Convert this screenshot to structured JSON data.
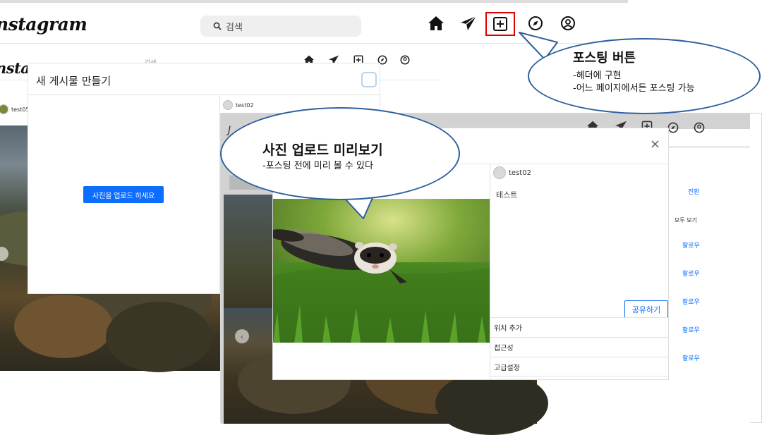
{
  "top_header": {
    "logo": "nstagram",
    "search_placeholder": "검색",
    "icons": [
      "home-icon",
      "send-icon",
      "new-post-icon",
      "compass-icon",
      "profile-icon"
    ]
  },
  "callout_posting": {
    "title": "포스팅 버튼",
    "line1": "-헤더에 구현",
    "line2": "-어느 페이지에서든 포스팅 가능"
  },
  "callout_preview": {
    "title": "사진 업로드 미리보기",
    "line1": "-포스팅 전에 미리 볼 수 있다"
  },
  "screenshot1": {
    "logo": "nstagra",
    "search_placeholder": "검색",
    "feed_user": "test05",
    "side_user": "test02",
    "modal": {
      "title": "새 게시물 만들기",
      "upload_button": "사진을 업로드 하세요"
    }
  },
  "screenshot2": {
    "side_switch": "전환",
    "side_see_all": "모두 보기",
    "follow_labels": [
      "팔로우",
      "팔로우",
      "팔로우",
      "팔로우",
      "팔로우"
    ],
    "modal": {
      "close": "×",
      "username": "test02",
      "caption": "테스트",
      "share_button": "공유하기",
      "options": [
        "위치 추가",
        "접근성",
        "고급설정"
      ]
    }
  },
  "colors": {
    "accent": "#0d6efd",
    "callout_border": "#2f5f9e",
    "highlight": "#e00000"
  }
}
